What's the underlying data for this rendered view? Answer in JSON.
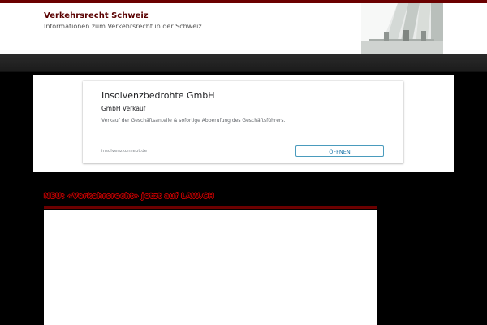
{
  "header": {
    "site_title": "Verkehrsrecht Schweiz",
    "tagline": "Informationen zum Verkehrsrecht in der Schweiz"
  },
  "ad": {
    "title": "Insolvenzbedrohte GmbH",
    "subtitle": "GmbH Verkauf",
    "description": "Verkauf der Geschäftsanteile & sofortige Abberufung des Geschäftsführers.",
    "domain": "insolvenzkonzept.de",
    "cta_label": "ÖFFNEN"
  },
  "post": {
    "title": "NEU: «Verkehrsrecht» jetzt auf LAW.CH"
  },
  "colors": {
    "accent": "#6b0000",
    "background": "#000000",
    "button_border": "#4a9bbd"
  }
}
